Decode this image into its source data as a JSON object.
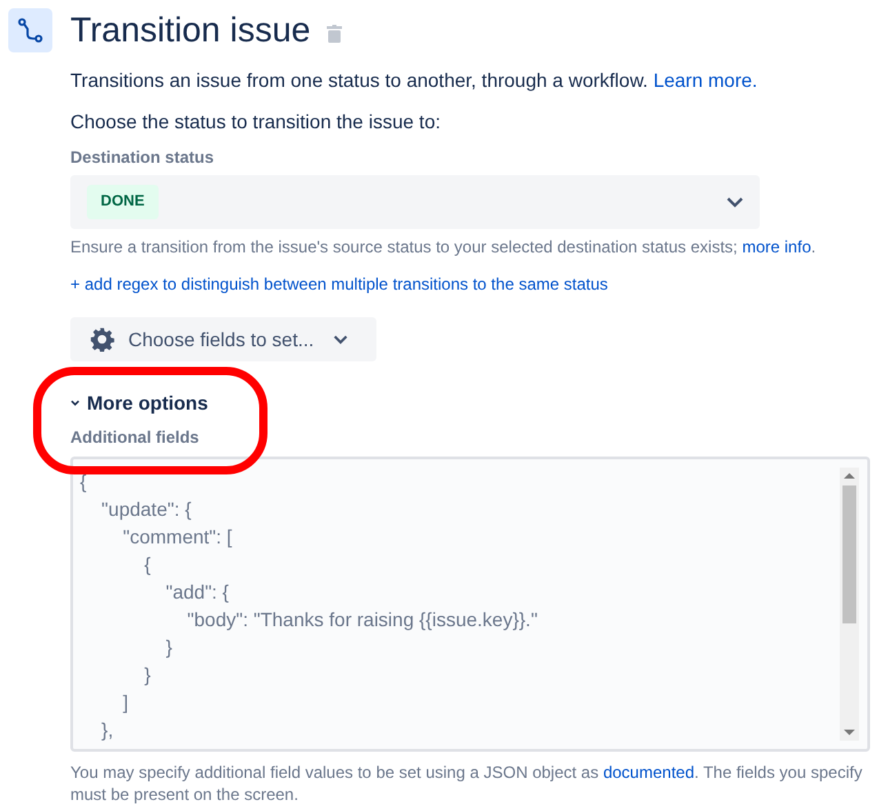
{
  "title": "Transition issue",
  "description": {
    "text": "Transitions an issue from one status to another, through a workflow.",
    "link": "Learn more."
  },
  "prompt": "Choose the status to transition the issue to:",
  "destination_status": {
    "label": "Destination status",
    "value": "DONE",
    "helper": "Ensure a transition from the issue's source status to your selected destination status exists;",
    "helper_link": "more info",
    "helper_end": "."
  },
  "regex_link": "+ add regex to distinguish between multiple transitions to the same status",
  "fields_button": "Choose fields to set...",
  "more_options": {
    "label": "More options",
    "expanded": true
  },
  "additional_fields": {
    "label": "Additional fields",
    "value": "{\n    \"update\": {\n        \"comment\": [\n            {\n                \"add\": {\n                    \"body\": \"Thanks for raising {{issue.key}}.\"\n                }\n            }\n        ]\n    },",
    "helper": "You may specify additional field values to be set using a JSON object as",
    "helper_link": "documented",
    "helper_end": ". The fields you specify must be present on the screen."
  }
}
